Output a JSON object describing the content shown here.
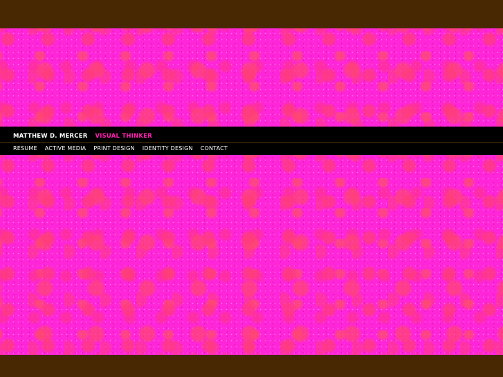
{
  "header": {
    "site_name": "MATTHEW D. MERCER",
    "tagline": "VISUAL THINKER"
  },
  "nav": {
    "items": [
      {
        "label": "RESUME"
      },
      {
        "label": "ACTIVE MEDIA"
      },
      {
        "label": "PRINT DESIGN"
      },
      {
        "label": "IDENTITY DESIGN"
      },
      {
        "label": "CONTACT"
      }
    ]
  },
  "colors": {
    "background_brown": "#472803",
    "pattern_magenta": "#ff26d9",
    "pattern_red": "#ff3c78",
    "header_black": "#000000",
    "tagline_pink": "#ff1fb0",
    "nav_white": "#ffffff"
  }
}
